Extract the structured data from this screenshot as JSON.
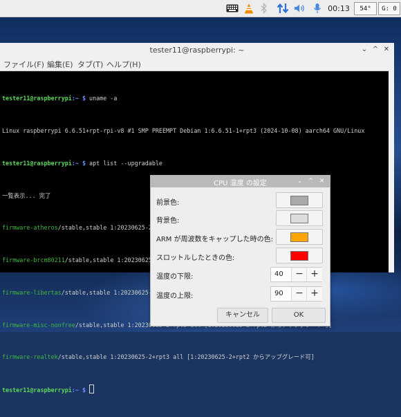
{
  "panel": {
    "clock": "00:13",
    "cpu_temp": "54°",
    "indicator": "G: 0",
    "icons": [
      "keyboard-icon",
      "vlc-icon",
      "bluetooth-icon",
      "network-icon",
      "volume-icon",
      "microphone-icon"
    ]
  },
  "terminal": {
    "title": "tester11@raspberrypi: ~",
    "controls": [
      "⌄",
      "^",
      "✕"
    ],
    "menu": [
      "ファイル(F)",
      "編集(E)",
      "タブ(T)",
      "ヘルプ(H)"
    ],
    "prompt_user": "tester11@raspberrypi",
    "prompt_path": ":~ $",
    "cmd1": " uname -a",
    "out1": "Linux raspberrypi 6.6.51+rpt-rpi-v8 #1 SMP PREEMPT Debian 1:6.6.51-1+rpt3 (2024-10-08) aarch64 GNU/Linux",
    "cmd2": " apt list --upgradable",
    "out2": "一覧表示... 完了",
    "packages": [
      {
        "name": "firmware-atheros",
        "rest": "/stable,stable 1:20230625-2+rpt3 all [1:20230625-2+rpt2 からアップグレード可]"
      },
      {
        "name": "firmware-brcm80211",
        "rest": "/stable,stable 1:20230625-2+rpt3 all [1:20230625-2+rpt2 からアップグレード可]"
      },
      {
        "name": "firmware-libertas",
        "rest": "/stable,stable 1:20230625-2+rpt3 all [1:20230625-2+rpt2 からアップグレード可]"
      },
      {
        "name": "firmware-misc-nonfree",
        "rest": "/stable,stable 1:20230625-2+rpt3 all [1:20230625-2+rpt2 からアップグレード可]"
      },
      {
        "name": "firmware-realtek",
        "rest": "/stable,stable 1:20230625-2+rpt3 all [1:20230625-2+rpt2 からアップグレード可]"
      }
    ]
  },
  "dialog": {
    "title": "CPU 温度 の設定",
    "controls": [
      "⌄",
      "^",
      "✕"
    ],
    "fg_label": "前景色:",
    "fg_color": "#a9a9a9",
    "bg_label": "背景色:",
    "bg_color": "#dcdcdc",
    "arm_label": "ARM が周波数をキャップした時の色:",
    "arm_color": "#ffa500",
    "throttle_label": "スロットルしたときの色:",
    "throttle_color": "#ff0000",
    "lower_label": "温度の下限:",
    "lower_value": "40",
    "upper_label": "温度の上限:",
    "upper_value": "90",
    "minus": "−",
    "plus": "+",
    "cancel": "キャンセル",
    "ok": "OK"
  }
}
